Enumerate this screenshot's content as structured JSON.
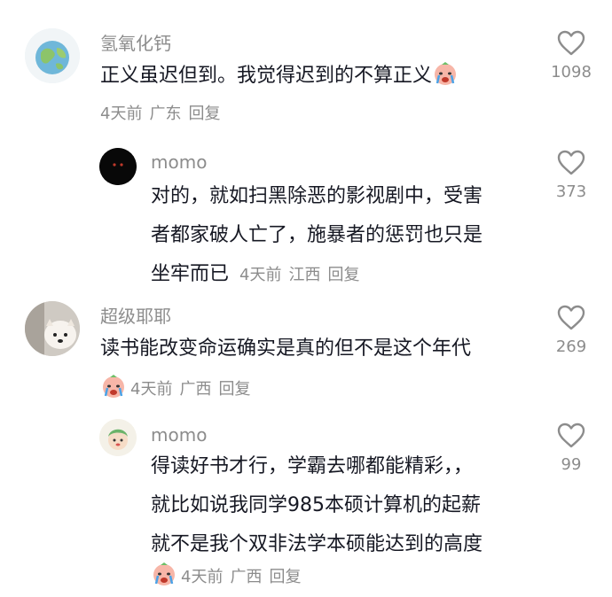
{
  "comments": [
    {
      "author": "氢氧化钙",
      "text_lines": [
        "正义虽迟但到。我觉得迟到的不算正义"
      ],
      "time": "4天前",
      "location": "广东",
      "reply_label": "回复",
      "likes": "1098",
      "avatar_icon": "globe-avatar",
      "emoji_icon": "crying-face-emoji"
    },
    {
      "author": "momo",
      "text_lines": [
        "对的，就如扫黑除恶的影视剧中，受害",
        "者都家破人亡了，施暴者的惩罚也只是",
        "坐牢而已"
      ],
      "time": "4天前",
      "location": "江西",
      "reply_label": "回复",
      "likes": "373",
      "avatar_icon": "dark-avatar"
    },
    {
      "author": "超级耶耶",
      "text_lines": [
        "读书能改变命运确实是真的但不是这个年代"
      ],
      "time": "4天前",
      "location": "广西",
      "reply_label": "回复",
      "likes": "269",
      "avatar_icon": "dog-avatar",
      "emoji_icon": "crying-face-emoji"
    },
    {
      "author": "momo",
      "text_lines": [
        "得读好书才行，学霸去哪都能精彩，，",
        "就比如说我同学985本硕计算机的起薪",
        "就不是我个双非法学本硕能达到的高度"
      ],
      "time": "4天前",
      "location": "广西",
      "reply_label": "回复",
      "likes": "99",
      "avatar_icon": "cartoon-avatar",
      "emoji_icon": "crying-face-emoji"
    }
  ],
  "colors": {
    "text": "#161823",
    "secondary": "#8c8c8c",
    "background": "#ffffff"
  }
}
